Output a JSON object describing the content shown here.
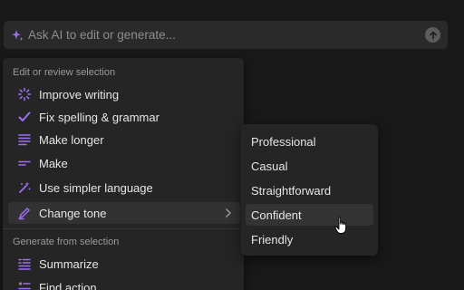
{
  "ai_bar": {
    "placeholder": "Ask AI to edit or generate...",
    "accent_color": "#9d6ff1"
  },
  "menu": {
    "section_edit_label": "Edit or review selection",
    "edit_items": [
      {
        "label": "Improve writing",
        "icon": "sparkle-burst-icon"
      },
      {
        "label": "Fix spelling & grammar",
        "icon": "checkmark-icon"
      },
      {
        "label": "Make longer",
        "icon": "lines-long-icon"
      },
      {
        "label": "Make",
        "icon": "lines-short-icon"
      },
      {
        "label": "Use simpler language",
        "icon": "magic-wand-icon"
      },
      {
        "label": "Change tone",
        "icon": "pen-icon",
        "active": true,
        "has_submenu": true
      }
    ],
    "section_generate_label": "Generate from selection",
    "generate_items": [
      {
        "label": "Summarize",
        "icon": "summary-lines-icon"
      },
      {
        "label": "Find action",
        "icon": "action-list-icon"
      }
    ]
  },
  "tone_submenu": {
    "items": [
      "Professional",
      "Casual",
      "Straightforward",
      "Confident",
      "Friendly"
    ],
    "hovered": "Confident"
  }
}
